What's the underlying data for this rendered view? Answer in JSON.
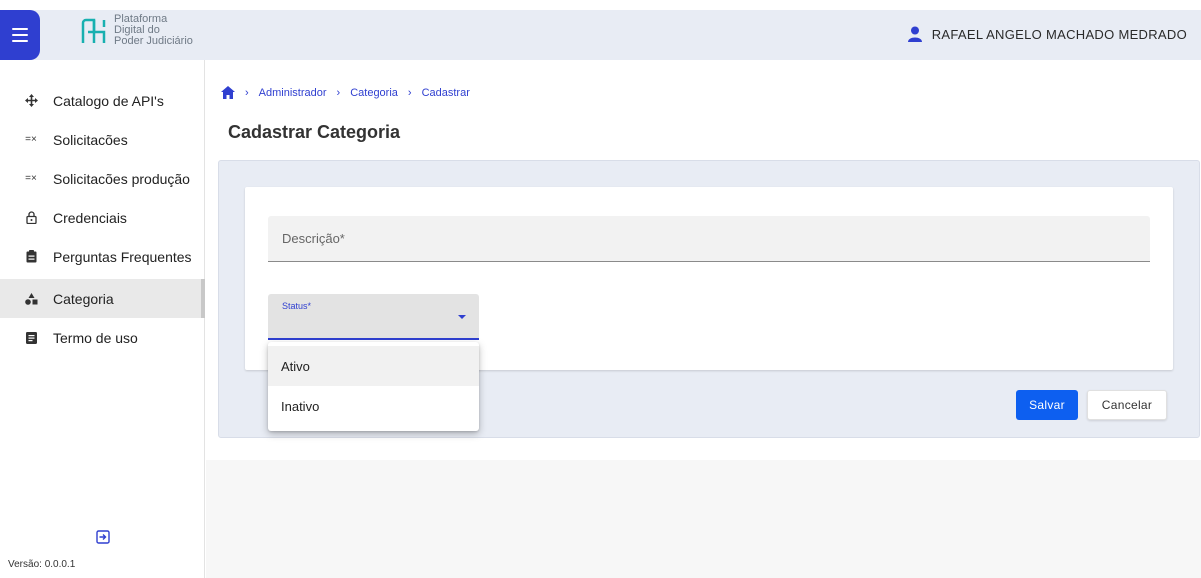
{
  "header": {
    "logo_lines": [
      "Plataforma",
      "Digital do",
      "Poder Judiciário"
    ],
    "user_name": "RAFAEL ANGELO MACHADO MEDRADO"
  },
  "sidebar": {
    "items": [
      {
        "label": "Catalogo de API's",
        "icon": "api-catalog-icon"
      },
      {
        "label": "Solicitacões",
        "icon": "requests-icon"
      },
      {
        "label": "Solicitacões produção",
        "icon": "production-requests-icon"
      },
      {
        "label": "Credenciais",
        "icon": "lock-icon"
      },
      {
        "label": "Perguntas Frequentes",
        "icon": "clipboard-icon"
      },
      {
        "label": "Categoria",
        "icon": "category-icon",
        "active": true
      },
      {
        "label": "Termo de uso",
        "icon": "document-icon"
      }
    ],
    "version": "Versão: 0.0.0.1"
  },
  "breadcrumb": [
    "Administrador",
    "Categoria",
    "Cadastrar"
  ],
  "page_title": "Cadastrar Categoria",
  "form": {
    "descricao_label": "Descrição*",
    "status_label": "Status*",
    "status_options": [
      "Ativo",
      "Inativo"
    ],
    "save_label": "Salvar",
    "cancel_label": "Cancelar"
  },
  "colors": {
    "primary": "#2f3fd0",
    "save_button": "#0d5ff0",
    "header_bg": "#e8ecf4"
  }
}
